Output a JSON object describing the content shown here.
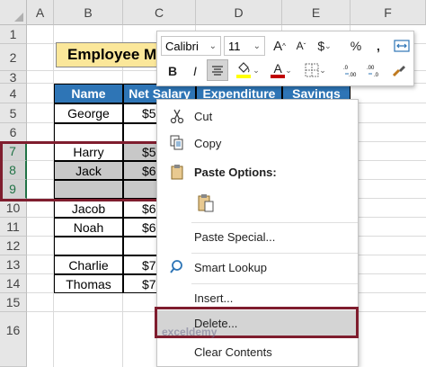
{
  "columns": [
    "A",
    "B",
    "C",
    "D",
    "E",
    "F"
  ],
  "rows": [
    "1",
    "2",
    "3",
    "4",
    "5",
    "6",
    "7",
    "8",
    "9",
    "10",
    "11",
    "12",
    "13",
    "14",
    "15",
    "16"
  ],
  "title": "Employee M",
  "table": {
    "headers": [
      "Name",
      "Net Salary",
      "Expenditure",
      "Savings"
    ],
    "names": [
      "George",
      "",
      "Harry",
      "Jack",
      "",
      "Jacob",
      "Noah",
      "",
      "Charlie",
      "Thomas"
    ],
    "salaries": [
      "$5,",
      "",
      "$5",
      "$6",
      "",
      "$6",
      "$6",
      "",
      "$7,",
      "$7,"
    ]
  },
  "mini_toolbar": {
    "font_name": "Calibri",
    "font_size": "11",
    "grow_font": "A",
    "shrink_font": "A",
    "currency": "$",
    "percent": "%",
    "bold": "B",
    "italic": "I",
    "font_color_letter": "A"
  },
  "context_menu": {
    "cut": "Cut",
    "copy": "Copy",
    "paste_options": "Paste Options:",
    "paste_special": "Paste Special...",
    "smart_lookup": "Smart Lookup",
    "insert": "Insert...",
    "delete": "Delete...",
    "clear_contents": "Clear Contents"
  },
  "watermark": "exceldemy",
  "colors": {
    "header_blue": "#2e75b6",
    "title_yellow": "#fbe79a",
    "highlight_maroon": "#7f1d2e",
    "arrow_orange": "#f0822a",
    "excel_green": "#217346"
  }
}
